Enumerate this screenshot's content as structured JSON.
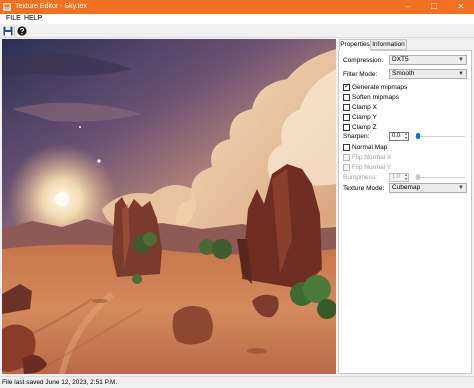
{
  "window": {
    "title": "Texture Editor - Sky.tex",
    "titlebar_color": "#f37021",
    "controls": {
      "minimize": "–",
      "maximize": "☐",
      "close": "✕"
    }
  },
  "menu": {
    "items": [
      "FILE",
      "HELP"
    ]
  },
  "toolbar": {
    "buttons": [
      "save-icon",
      "help-icon"
    ]
  },
  "viewport": {
    "content": "sky-texture-desert-canyon-sunset"
  },
  "panel": {
    "tabs": [
      {
        "label": "Properties",
        "active": true
      },
      {
        "label": "Information",
        "active": false
      }
    ],
    "compression": {
      "label": "Compression:",
      "value": "DXT5"
    },
    "filter_mode": {
      "label": "Filter Mode:",
      "value": "Smooth"
    },
    "checks": [
      {
        "label": "Generate mipmaps",
        "checked": true,
        "enabled": true
      },
      {
        "label": "Soften mipmaps",
        "checked": false,
        "enabled": true
      },
      {
        "label": "Clamp X",
        "checked": false,
        "enabled": true
      },
      {
        "label": "Clamp Y",
        "checked": false,
        "enabled": true
      },
      {
        "label": "Clamp Z",
        "checked": false,
        "enabled": true
      }
    ],
    "sharpen": {
      "label": "Sharpen:",
      "value": "0.0",
      "level": 0
    },
    "normal_map": {
      "label": "Normal Map",
      "checked": false
    },
    "flip_normal_x": {
      "label": "Flip Normal X",
      "checked": false,
      "enabled": false
    },
    "flip_normal_y": {
      "label": "Flip Normal Y",
      "checked": false,
      "enabled": false
    },
    "bumpiness": {
      "label": "Bumpiness:",
      "value": "1.0",
      "level": 0
    },
    "texture_mode": {
      "label": "Texture Mode:",
      "value": "Cubemap"
    }
  },
  "status": {
    "text": "File last saved June 12, 2023, 2:51 P.M."
  },
  "colors": {
    "slider_thumb": "#0078d7",
    "panel_bg": "#ffffff"
  }
}
